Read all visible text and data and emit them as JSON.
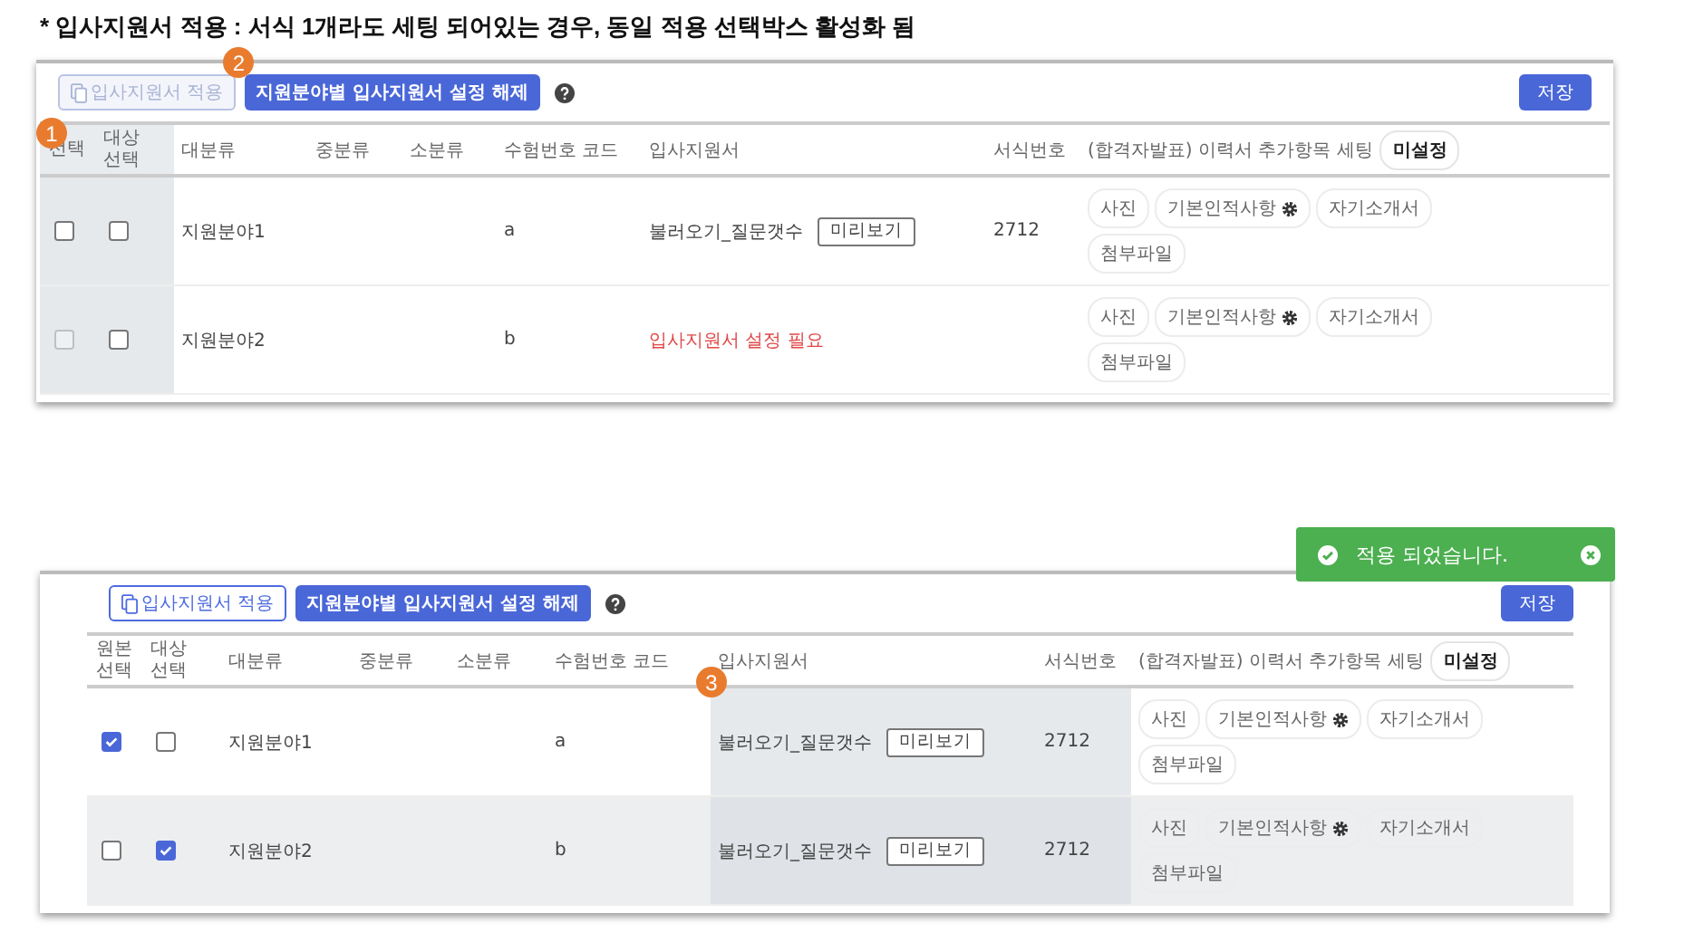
{
  "note": "* 입사지원서 적용 : 서식 1개라도 세팅 되어있는 경우, 동일 적용 선택박스 활성화 됨",
  "panels": [
    {
      "apply_button": {
        "label": "입사지원서 적용",
        "disabled": true,
        "badge": "2"
      },
      "reset_button": "지원분야별 입사지원서 설정 해제",
      "save_button": "저장",
      "settings_chip": "미설정",
      "columns": [
        {
          "label": "선택",
          "highlighted": true,
          "badge": "1"
        },
        {
          "label": "대상 선택",
          "highlighted": true
        },
        {
          "label": "대분류",
          "highlighted": false
        },
        {
          "label": "중분류",
          "highlighted": false
        },
        {
          "label": "소분류",
          "highlighted": false
        },
        {
          "label": "수험번호 코드",
          "highlighted": false
        },
        {
          "label": "입사지원서",
          "highlighted": false
        },
        {
          "label": "서식번호",
          "highlighted": false
        },
        {
          "label": "(합격자발표) 이력서 추가항목 세팅",
          "highlighted": false
        }
      ],
      "rows": [
        {
          "original": {
            "checked": false,
            "disabled": false
          },
          "target": {
            "checked": false,
            "disabled": false
          },
          "category": "지원분야1",
          "code": "a",
          "form": {
            "kind": "loaded",
            "text": "불러오기_질문갯수",
            "preview": "미리보기"
          },
          "form_number": "2712",
          "shaded": false,
          "tags": [
            {
              "label": "사진",
              "gear": false
            },
            {
              "label": "기본인적사항",
              "gear": true
            },
            {
              "label": "자기소개서",
              "gear": false
            },
            {
              "label": "첨부파일",
              "gear": false
            }
          ]
        },
        {
          "original": {
            "checked": false,
            "disabled": true
          },
          "target": {
            "checked": false,
            "disabled": false
          },
          "category": "지원분야2",
          "code": "b",
          "form": {
            "kind": "missing",
            "text": "입사지원서 설정 필요"
          },
          "shaded": false,
          "tags": [
            {
              "label": "사진",
              "gear": false
            },
            {
              "label": "기본인적사항",
              "gear": true
            },
            {
              "label": "자기소개서",
              "gear": false
            },
            {
              "label": "첨부파일",
              "gear": false
            }
          ]
        }
      ]
    },
    {
      "apply_button": {
        "label": "입사지원서 적용",
        "disabled": false
      },
      "reset_button": "지원분야별 입사지원서 설정 해제",
      "save_button": "저장",
      "settings_chip": "미설정",
      "toast": {
        "message": "적용 되었습니다."
      },
      "columns": [
        {
          "label": "원본 선택",
          "highlighted": false
        },
        {
          "label": "대상 선택",
          "highlighted": false
        },
        {
          "label": "대분류",
          "highlighted": false
        },
        {
          "label": "중분류",
          "highlighted": false
        },
        {
          "label": "소분류",
          "highlighted": false
        },
        {
          "label": "수험번호 코드",
          "highlighted": false
        },
        {
          "label": "입사지원서",
          "highlighted": true
        },
        {
          "label": "서식번호",
          "highlighted": true
        },
        {
          "label": "(합격자발표) 이력서 추가항목 세팅",
          "highlighted": false
        }
      ],
      "rows": [
        {
          "original": {
            "checked": true,
            "disabled": false
          },
          "target": {
            "checked": false,
            "disabled": false
          },
          "category": "지원분야1",
          "code": "a",
          "form": {
            "kind": "loaded",
            "text": "불러오기_질문갯수",
            "preview": "미리보기",
            "badge": "3"
          },
          "form_number": "2712",
          "shaded": false,
          "tags": [
            {
              "label": "사진",
              "gear": false
            },
            {
              "label": "기본인적사항",
              "gear": true
            },
            {
              "label": "자기소개서",
              "gear": false
            },
            {
              "label": "첨부파일",
              "gear": false
            }
          ]
        },
        {
          "original": {
            "checked": false,
            "disabled": false
          },
          "target": {
            "checked": true,
            "disabled": false
          },
          "category": "지원분야2",
          "code": "b",
          "form": {
            "kind": "loaded",
            "text": "불러오기_질문갯수",
            "preview": "미리보기"
          },
          "form_number": "2712",
          "shaded": true,
          "tags": [
            {
              "label": "사진",
              "gear": false
            },
            {
              "label": "기본인적사항",
              "gear": true
            },
            {
              "label": "자기소개서",
              "gear": false
            },
            {
              "label": "첨부파일",
              "gear": false
            }
          ]
        }
      ]
    }
  ]
}
